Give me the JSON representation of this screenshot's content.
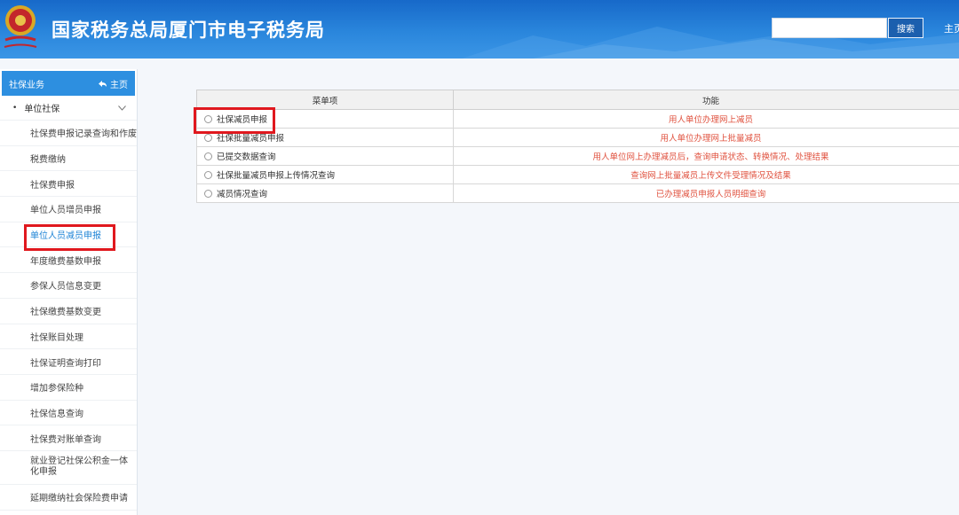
{
  "header": {
    "title": "国家税务总局厦门市电子税务局",
    "search_placeholder": "",
    "search_label": "搜索",
    "home_label": "主页",
    "colors": {
      "primary": "#1f77d0",
      "accent": "#e0181e"
    }
  },
  "sidebar": {
    "title": "社保业务",
    "home_label": "主页",
    "group": {
      "label": "单位社保"
    },
    "items": [
      {
        "label": "社保费申报记录查询和作废"
      },
      {
        "label": "税费缴纳"
      },
      {
        "label": "社保费申报"
      },
      {
        "label": "单位人员增员申报"
      },
      {
        "label": "单位人员减员申报"
      },
      {
        "label": "年度缴费基数申报"
      },
      {
        "label": "参保人员信息变更"
      },
      {
        "label": "社保缴费基数变更"
      },
      {
        "label": "社保账目处理"
      },
      {
        "label": "社保证明查询打印"
      },
      {
        "label": "增加参保险种"
      },
      {
        "label": "社保信息查询"
      },
      {
        "label": "社保费对账单查询"
      },
      {
        "label": "就业登记社保公积金一体化申报"
      },
      {
        "label": "延期缴纳社会保险费申请"
      }
    ]
  },
  "table": {
    "headers": {
      "menu": "菜单项",
      "function": "功能"
    },
    "rows": [
      {
        "menu": "社保减员申报",
        "function": "用人单位办理网上减员"
      },
      {
        "menu": "社保批量减员申报",
        "function": "用人单位办理网上批量减员"
      },
      {
        "menu": "已提交数据查询",
        "function": "用人单位网上办理减员后，查询申请状态、转换情况、处理结果"
      },
      {
        "menu": "社保批量减员申报上传情况查询",
        "function": "查询网上批量减员上传文件受理情况及结果"
      },
      {
        "menu": "减员情况查询",
        "function": "已办理减员申报人员明细查询"
      }
    ]
  }
}
